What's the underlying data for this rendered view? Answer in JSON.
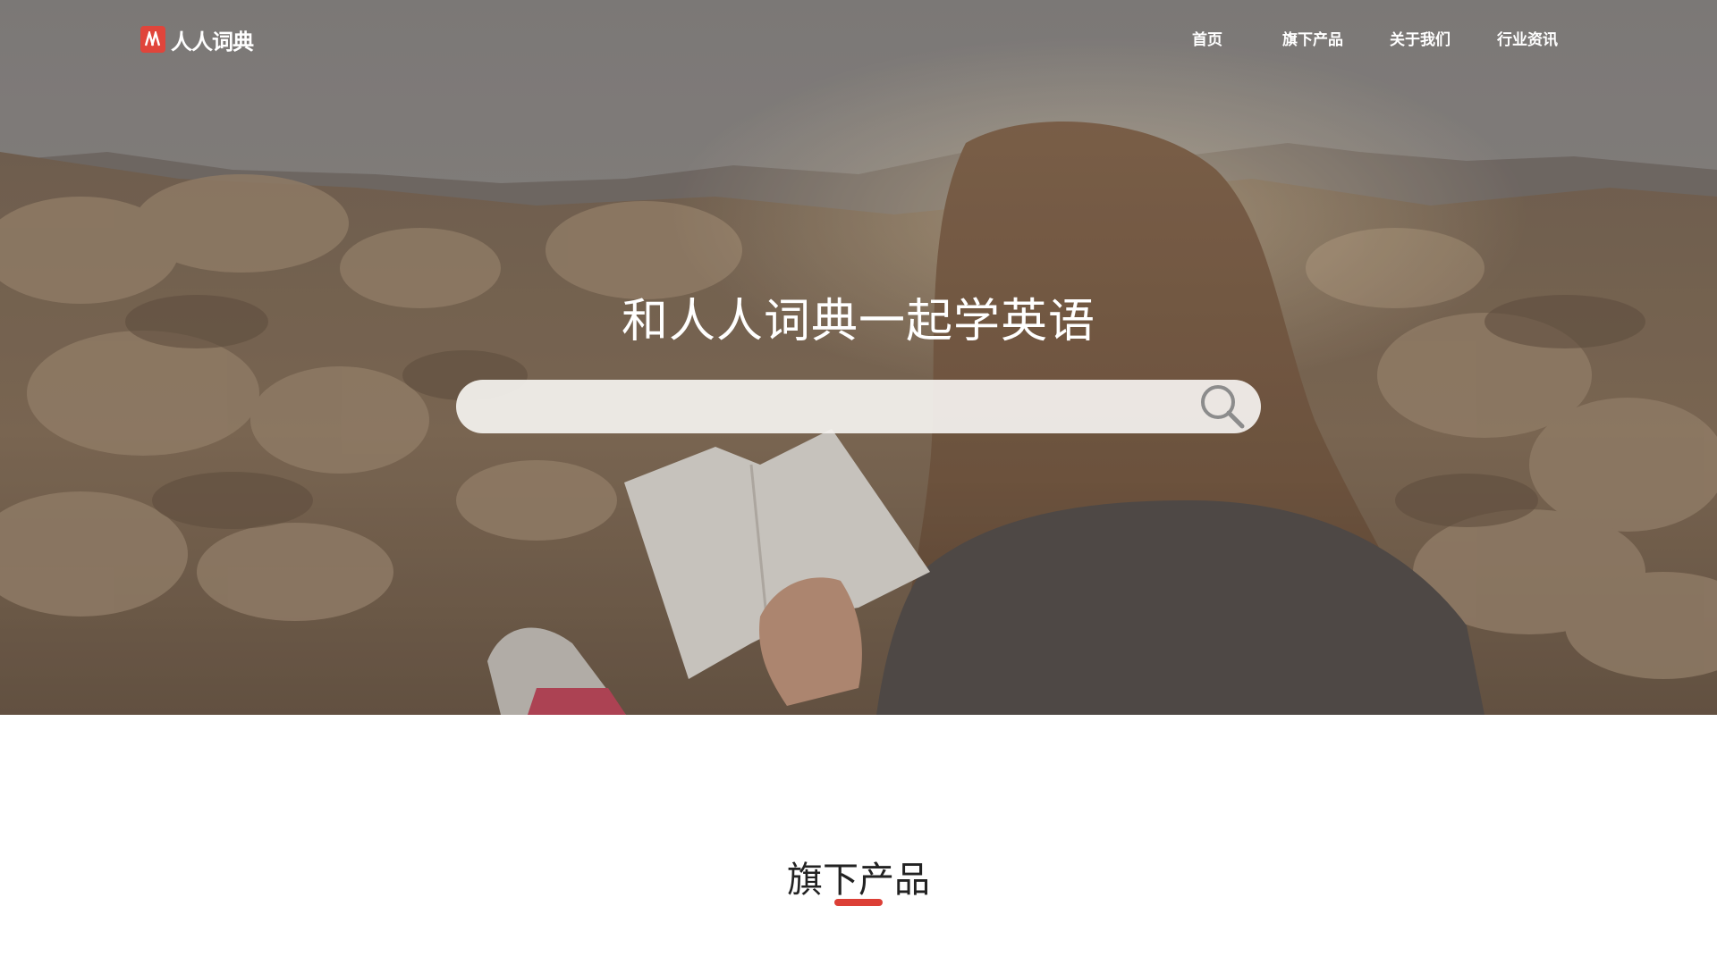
{
  "header": {
    "logo_text": "人人词典",
    "nav": [
      {
        "label": "首页"
      },
      {
        "label": "旗下产品"
      },
      {
        "label": "关于我们"
      },
      {
        "label": "行业资讯"
      }
    ]
  },
  "hero": {
    "title": "和人人词典一起学英语",
    "search": {
      "value": "",
      "placeholder": "",
      "icon": "search-icon"
    }
  },
  "products_section": {
    "title": "旗下产品"
  },
  "colors": {
    "accent": "#dc3f36",
    "logo_mark": "#e0453b",
    "title_text": "#222222"
  }
}
